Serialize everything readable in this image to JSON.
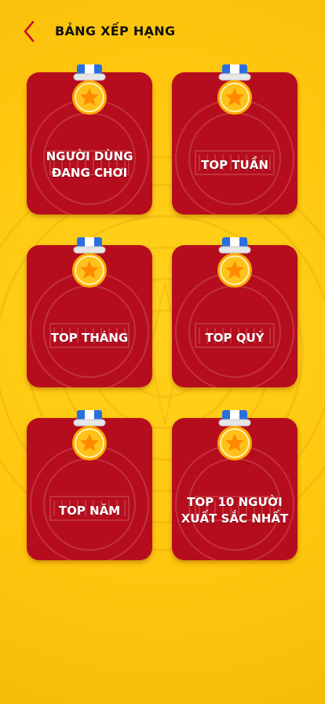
{
  "header": {
    "title": "BẢNG XẾP HẠNG",
    "back_icon": "chevron-left-icon"
  },
  "cards": [
    {
      "label": "NGƯỜI DÙNG\nĐANG CHƠI"
    },
    {
      "label": "TOP TUẦN"
    },
    {
      "label": "TOP THÁNG"
    },
    {
      "label": "TOP QUÝ"
    },
    {
      "label": "TOP NĂM"
    },
    {
      "label": "TOP 10 NGƯỜI\nXUẤT SẮC NHẤT"
    }
  ],
  "colors": {
    "background": "#ffc80f",
    "card": "#b50d1e",
    "accent": "#c8102e",
    "medal_gold": "#ffc21a",
    "ribbon_blue": "#2a6fe0"
  }
}
